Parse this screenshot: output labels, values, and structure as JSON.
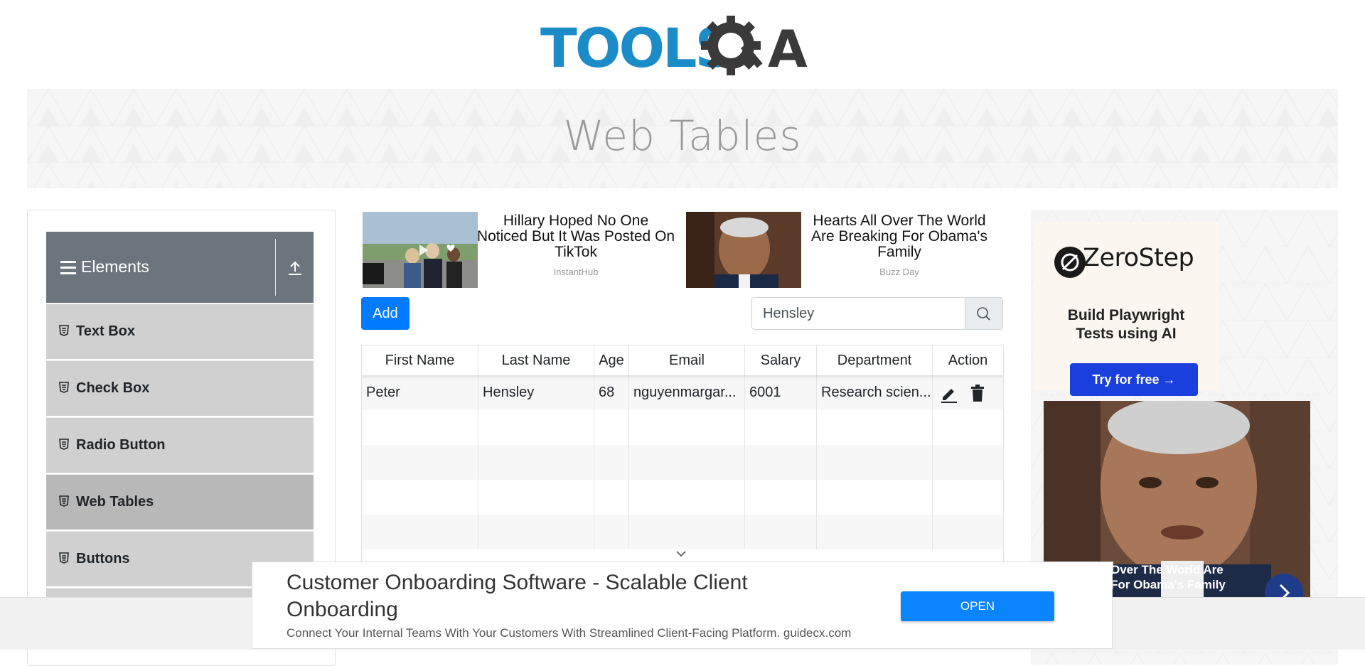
{
  "header": {
    "logo_text_left": "TOOLS",
    "logo_text_right": "A",
    "banner_title": "Web Tables"
  },
  "sidebar": {
    "group_title": "Elements",
    "items": [
      {
        "label": "Text Box"
      },
      {
        "label": "Check Box"
      },
      {
        "label": "Radio Button"
      },
      {
        "label": "Web Tables",
        "active": true
      },
      {
        "label": "Buttons"
      }
    ]
  },
  "ads_row": [
    {
      "title": "Hillary Hoped No One Noticed But It Was Posted On TikTok",
      "source": "InstantHub"
    },
    {
      "title": "Hearts All Over The World Are Breaking For Obama's Family",
      "source": "Buzz Day"
    }
  ],
  "toolbar": {
    "add_label": "Add",
    "search_value": "Hensley"
  },
  "table": {
    "columns": [
      "First Name",
      "Last Name",
      "Age",
      "Email",
      "Salary",
      "Department",
      "Action"
    ],
    "rows": [
      [
        "Peter",
        "Hensley",
        "68",
        "nguyenmargar...",
        "6001",
        "Research scien..."
      ]
    ]
  },
  "right_ad": {
    "brand": "ZeroStep",
    "tagline_1": "Build Playwright",
    "tagline_2": "Tests using AI",
    "cta": "Try for free →",
    "caption_1": "Over The World Are",
    "caption_2": "For Obama's Family"
  },
  "bottom_ad": {
    "title": "Customer Onboarding Software - Scalable Client Onboarding",
    "description": "Connect Your Internal Teams With Your Customers With Streamlined Client-Facing Platform. guidecx.com",
    "open_label": "OPEN"
  },
  "colors": {
    "primary": "#007bff",
    "logo_blue": "#1c8cc8",
    "logo_dark": "#3a3a3a",
    "group_header": "#6c757d",
    "menu_item": "#d0d0d0"
  }
}
